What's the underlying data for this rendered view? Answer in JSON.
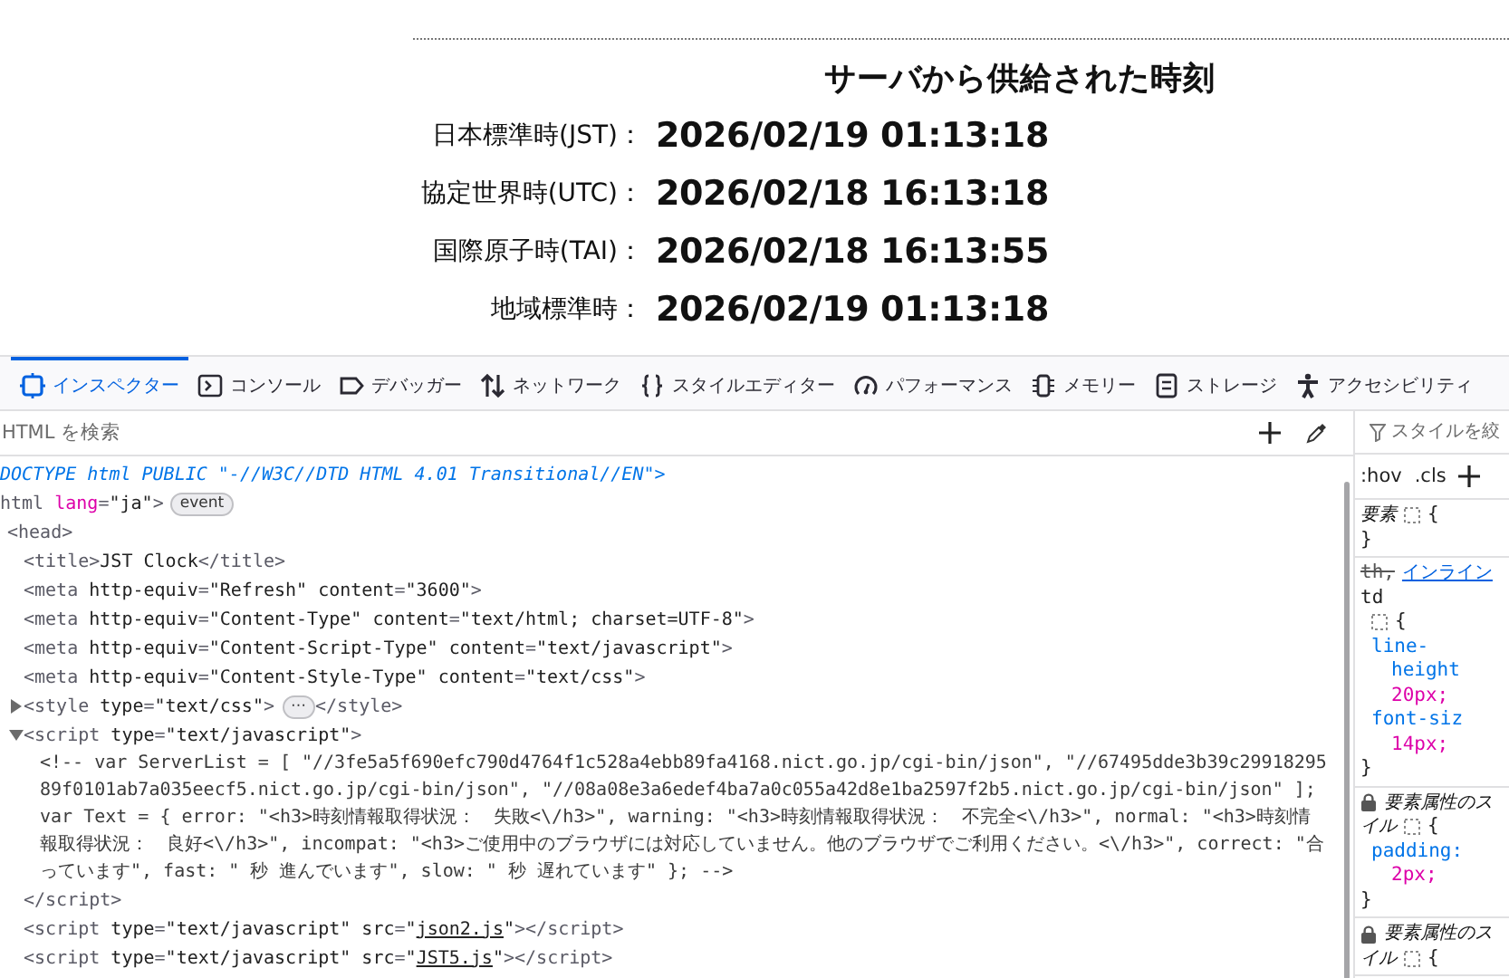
{
  "page": {
    "heading": "サーバから供給された時刻",
    "rows": [
      {
        "label": "日本標準時(JST)：",
        "value": "2026/02/19 01:13:18"
      },
      {
        "label": "協定世界時(UTC)：",
        "value": "2026/02/18 16:13:18"
      },
      {
        "label": "国際原子時(TAI)：",
        "value": "2026/02/18 16:13:55"
      },
      {
        "label": "地域標準時：",
        "value": "2026/02/19 01:13:18"
      }
    ]
  },
  "devtools": {
    "tabs": [
      {
        "label": "インスペクター",
        "selected": true
      },
      {
        "label": "コンソール",
        "selected": false
      },
      {
        "label": "デバッガー",
        "selected": false
      },
      {
        "label": "ネットワーク",
        "selected": false
      },
      {
        "label": "スタイルエディター",
        "selected": false
      },
      {
        "label": "パフォーマンス",
        "selected": false
      },
      {
        "label": "メモリー",
        "selected": false
      },
      {
        "label": "ストレージ",
        "selected": false
      },
      {
        "label": "アクセシビリティ",
        "selected": false
      }
    ],
    "search": {
      "placeholder": "HTML を検索"
    },
    "style_filter": {
      "placeholder": "スタイルを絞"
    },
    "pseudo_buttons": [
      ":hov",
      ".cls"
    ],
    "tree": [
      {
        "tokens": [
          {
            "kind": "doctype",
            "text": "DOCTYPE html PUBLIC \"-//W3C//DTD HTML 4.01 Transitional//EN\">"
          }
        ]
      },
      {
        "tokens": [
          {
            "kind": "tag",
            "text": "html"
          },
          {
            "kind": "attr-changed",
            "text": " lang"
          },
          {
            "kind": "tag",
            "text": "="
          },
          {
            "kind": "value",
            "text": "\"ja\""
          },
          {
            "kind": "tag",
            "text": ">"
          }
        ],
        "badge": "event",
        "children": [
          {
            "tokens": [
              {
                "kind": "tag",
                "text": "<head>"
              }
            ],
            "children": [
              {
                "tokens": [
                  {
                    "kind": "tag",
                    "text": "<title>"
                  },
                  {
                    "kind": "plain",
                    "text": "JST Clock"
                  },
                  {
                    "kind": "tag",
                    "text": "</title>"
                  }
                ]
              },
              {
                "tokens": [
                  {
                    "kind": "tag",
                    "text": "<meta"
                  },
                  {
                    "kind": "attr",
                    "text": " http-equiv"
                  },
                  {
                    "kind": "tag",
                    "text": "="
                  },
                  {
                    "kind": "value",
                    "text": "\"Refresh\""
                  },
                  {
                    "kind": "attr",
                    "text": " content"
                  },
                  {
                    "kind": "tag",
                    "text": "="
                  },
                  {
                    "kind": "value",
                    "text": "\"3600\""
                  },
                  {
                    "kind": "tag",
                    "text": ">"
                  }
                ]
              },
              {
                "tokens": [
                  {
                    "kind": "tag",
                    "text": "<meta"
                  },
                  {
                    "kind": "attr",
                    "text": " http-equiv"
                  },
                  {
                    "kind": "tag",
                    "text": "="
                  },
                  {
                    "kind": "value",
                    "text": "\"Content-Type\""
                  },
                  {
                    "kind": "attr",
                    "text": " content"
                  },
                  {
                    "kind": "tag",
                    "text": "="
                  },
                  {
                    "kind": "value",
                    "text": "\"text/html; charset=UTF-8\""
                  },
                  {
                    "kind": "tag",
                    "text": ">"
                  }
                ]
              },
              {
                "tokens": [
                  {
                    "kind": "tag",
                    "text": "<meta"
                  },
                  {
                    "kind": "attr",
                    "text": " http-equiv"
                  },
                  {
                    "kind": "tag",
                    "text": "="
                  },
                  {
                    "kind": "value",
                    "text": "\"Content-Script-Type\""
                  },
                  {
                    "kind": "attr",
                    "text": " content"
                  },
                  {
                    "kind": "tag",
                    "text": "="
                  },
                  {
                    "kind": "value",
                    "text": "\"text/javascript\""
                  },
                  {
                    "kind": "tag",
                    "text": ">"
                  }
                ]
              },
              {
                "tokens": [
                  {
                    "kind": "tag",
                    "text": "<meta"
                  },
                  {
                    "kind": "attr",
                    "text": " http-equiv"
                  },
                  {
                    "kind": "tag",
                    "text": "="
                  },
                  {
                    "kind": "value",
                    "text": "\"Content-Style-Type\""
                  },
                  {
                    "kind": "attr",
                    "text": " content"
                  },
                  {
                    "kind": "tag",
                    "text": "="
                  },
                  {
                    "kind": "value",
                    "text": "\"text/css\""
                  },
                  {
                    "kind": "tag",
                    "text": ">"
                  }
                ]
              },
              {
                "expanded": false,
                "tokens": [
                  {
                    "kind": "tag",
                    "text": "<style"
                  },
                  {
                    "kind": "attr",
                    "text": " type"
                  },
                  {
                    "kind": "tag",
                    "text": "="
                  },
                  {
                    "kind": "value",
                    "text": "\"text/css\""
                  },
                  {
                    "kind": "tag",
                    "text": ">"
                  }
                ],
                "badge": "⋯",
                "after": [
                  {
                    "kind": "tag",
                    "text": "</style>"
                  }
                ]
              },
              {
                "expanded": true,
                "tokens": [
                  {
                    "kind": "tag",
                    "text": "<script"
                  },
                  {
                    "kind": "attr",
                    "text": " type"
                  },
                  {
                    "kind": "tag",
                    "text": "="
                  },
                  {
                    "kind": "value",
                    "text": "\"text/javascript\""
                  },
                  {
                    "kind": "tag",
                    "text": ">"
                  }
                ],
                "children": [
                  {
                    "tokens": [
                      {
                        "kind": "comment",
                        "text": "<!-- var ServerList = [ \"//3fe5a5f690efc790d4764f1c528a4ebb89fa4168.nict.go.jp/cgi-bin/json\", \"//67495dde3b39c2991829589f0101ab7a035eecf5.nict.go.jp/cgi-bin/json\", \"//08a08e3a6edef4ba7a0c055a42d8e1ba2597f2b5.nict.go.jp/cgi-bin/json\" ]; var Text = { error: \"<h3>時刻情報取得状況：　失敗<\\/h3>\", warning: \"<h3>時刻情報取得状況：　不完全<\\/h3>\", normal: \"<h3>時刻情報取得状況：　良好<\\/h3>\", incompat: \"<h3>ご使用中のブラウザには対応していません。他のブラウザでご利用ください。<\\/h3>\", correct: \"合っています\", fast: \" 秒 進んでいます\", slow: \" 秒 遅れています\" }; -->"
                      }
                    ]
                  }
                ],
                "close": [
                  {
                    "kind": "tag",
                    "text": "</script>"
                  }
                ]
              },
              {
                "tokens": [
                  {
                    "kind": "tag",
                    "text": "<script"
                  },
                  {
                    "kind": "attr",
                    "text": " type"
                  },
                  {
                    "kind": "tag",
                    "text": "="
                  },
                  {
                    "kind": "value",
                    "text": "\"text/javascript\""
                  },
                  {
                    "kind": "attr",
                    "text": " src"
                  },
                  {
                    "kind": "tag",
                    "text": "="
                  },
                  {
                    "kind": "value",
                    "text": "\""
                  },
                  {
                    "kind": "link",
                    "text": "json2.js"
                  },
                  {
                    "kind": "value",
                    "text": "\""
                  },
                  {
                    "kind": "tag",
                    "text": "></script>"
                  }
                ]
              },
              {
                "tokens": [
                  {
                    "kind": "tag",
                    "text": "<script"
                  },
                  {
                    "kind": "attr",
                    "text": " type"
                  },
                  {
                    "kind": "tag",
                    "text": "="
                  },
                  {
                    "kind": "value",
                    "text": "\"text/javascript\""
                  },
                  {
                    "kind": "attr",
                    "text": " src"
                  },
                  {
                    "kind": "tag",
                    "text": "="
                  },
                  {
                    "kind": "value",
                    "text": "\""
                  },
                  {
                    "kind": "link",
                    "text": "JST5.js"
                  },
                  {
                    "kind": "value",
                    "text": "\""
                  },
                  {
                    "kind": "tag",
                    "text": "></script>"
                  }
                ]
              }
            ]
          }
        ]
      }
    ],
    "rules": [
      {
        "locked": false,
        "lines": [
          {
            "kind": "selector",
            "parts": [
              {
                "kind": "italic",
                "text": "要素"
              }
            ],
            "trail": "{"
          },
          {
            "kind": "close",
            "parts": [
              {
                "kind": "brace",
                "text": "}"
              }
            ]
          }
        ]
      },
      {
        "locked": false,
        "lines": [
          {
            "kind": "selector",
            "parts": [
              {
                "kind": "struck",
                "text": "th,"
              },
              {
                "kind": "link",
                "text": "インライン"
              }
            ]
          },
          {
            "kind": "selector",
            "parts": [
              {
                "kind": "plain",
                "text": "td"
              }
            ]
          },
          {
            "kind": "open",
            "trail": "{"
          },
          {
            "kind": "property",
            "parts": [
              {
                "kind": "property",
                "text": "line-"
              }
            ]
          },
          {
            "kind": "property-wrap",
            "parts": [
              {
                "kind": "property",
                "text": "height"
              }
            ]
          },
          {
            "kind": "value",
            "parts": [
              {
                "kind": "value",
                "text": "20px;"
              }
            ]
          },
          {
            "kind": "property",
            "parts": [
              {
                "kind": "property",
                "text": "font-siz"
              }
            ]
          },
          {
            "kind": "value",
            "parts": [
              {
                "kind": "value",
                "text": "14px;"
              }
            ]
          },
          {
            "kind": "close",
            "parts": [
              {
                "kind": "brace",
                "text": "}"
              }
            ]
          }
        ]
      },
      {
        "locked": true,
        "lines": [
          {
            "kind": "selector",
            "parts": [
              {
                "kind": "italic",
                "text": "要素属性のス"
              }
            ]
          },
          {
            "kind": "selector",
            "parts": [
              {
                "kind": "italic",
                "text": "イル"
              }
            ],
            "trail": "{"
          },
          {
            "kind": "property",
            "parts": [
              {
                "kind": "property",
                "text": "padding:"
              }
            ]
          },
          {
            "kind": "value",
            "parts": [
              {
                "kind": "value",
                "text": "2px;"
              }
            ]
          },
          {
            "kind": "close",
            "parts": [
              {
                "kind": "brace",
                "text": "}"
              }
            ]
          }
        ]
      },
      {
        "locked": true,
        "lines": [
          {
            "kind": "selector",
            "parts": [
              {
                "kind": "italic",
                "text": "要素属性のス"
              }
            ]
          },
          {
            "kind": "selector",
            "parts": [
              {
                "kind": "italic",
                "text": "イル"
              }
            ],
            "trail": "{"
          }
        ]
      }
    ]
  }
}
